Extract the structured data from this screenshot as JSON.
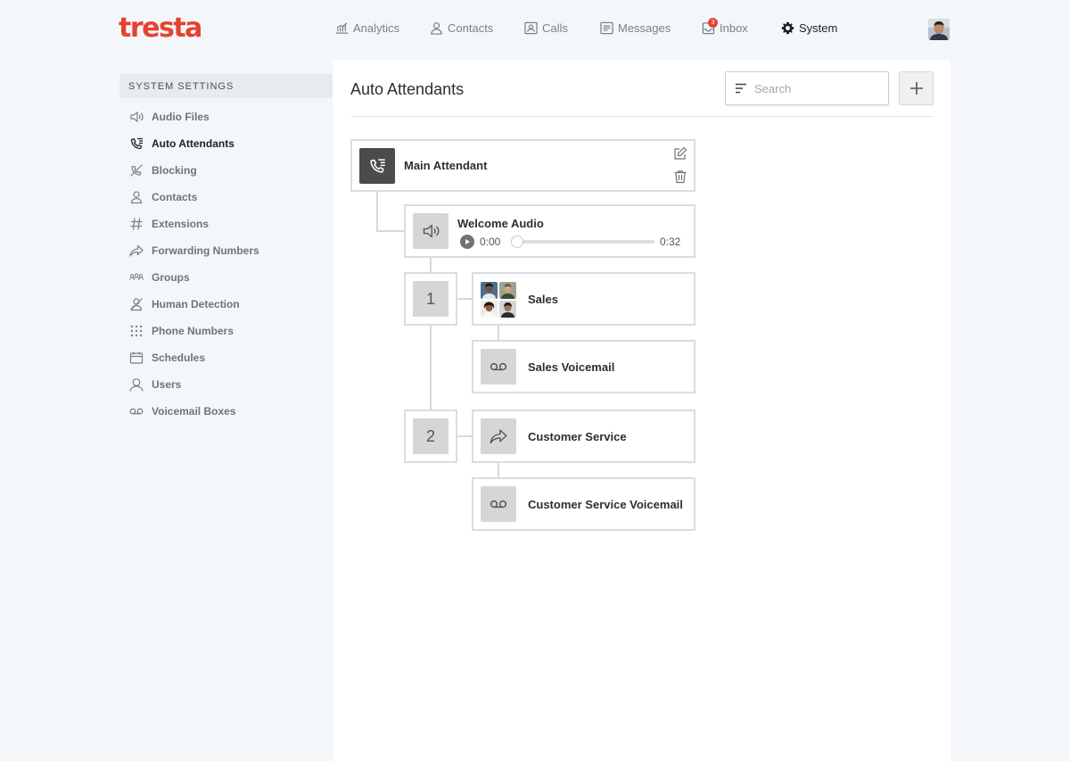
{
  "brand": {
    "logo": "tresta",
    "accent": "#e5432f"
  },
  "nav": {
    "items": [
      {
        "label": "Analytics",
        "icon": "analytics-icon"
      },
      {
        "label": "Contacts",
        "icon": "contact-icon"
      },
      {
        "label": "Calls",
        "icon": "calls-icon"
      },
      {
        "label": "Messages",
        "icon": "messages-icon"
      },
      {
        "label": "Inbox",
        "icon": "inbox-icon",
        "badge": "3"
      },
      {
        "label": "System",
        "icon": "gear-icon",
        "active": true
      }
    ]
  },
  "sidebar": {
    "header": "SYSTEM SETTINGS",
    "items": [
      {
        "label": "Audio Files",
        "icon": "speaker-icon"
      },
      {
        "label": "Auto Attendants",
        "icon": "auto-attendant-icon",
        "active": true
      },
      {
        "label": "Blocking",
        "icon": "blocking-icon"
      },
      {
        "label": "Contacts",
        "icon": "contact-icon"
      },
      {
        "label": "Extensions",
        "icon": "hash-icon"
      },
      {
        "label": "Forwarding Numbers",
        "icon": "forward-icon"
      },
      {
        "label": "Groups",
        "icon": "groups-icon"
      },
      {
        "label": "Human Detection",
        "icon": "human-detection-icon"
      },
      {
        "label": "Phone Numbers",
        "icon": "keypad-icon"
      },
      {
        "label": "Schedules",
        "icon": "calendar-icon"
      },
      {
        "label": "Users",
        "icon": "user-icon"
      },
      {
        "label": "Voicemail Boxes",
        "icon": "voicemail-icon"
      }
    ]
  },
  "main": {
    "title": "Auto Attendants",
    "search_placeholder": "Search",
    "tree": {
      "root": {
        "title": "Main Attendant"
      },
      "welcome": {
        "title": "Welcome Audio",
        "current_time": "0:00",
        "duration": "0:32",
        "progress": 0
      },
      "options": [
        {
          "key": "1",
          "destination": "Sales",
          "fallback": "Sales Voicemail"
        },
        {
          "key": "2",
          "destination": "Customer Service",
          "fallback": "Customer Service Voicemail"
        }
      ]
    }
  }
}
